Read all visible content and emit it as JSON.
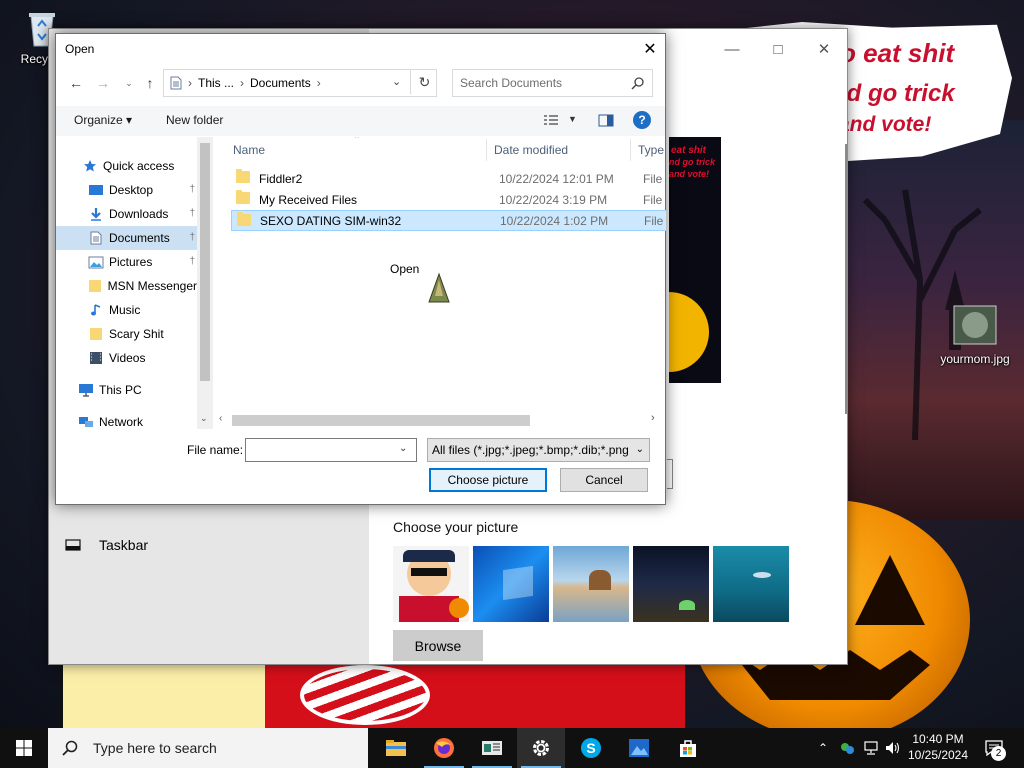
{
  "desktop": {
    "icons": [
      {
        "label": "Recycle"
      },
      {
        "label": "yourmom.jpg"
      }
    ],
    "wallpaper_text": [
      "o eat shit",
      "nd go trick",
      "and vote!"
    ]
  },
  "settings_window": {
    "nav_taskbar_label": "Taskbar",
    "choose_picture_label": "Choose your picture",
    "browse_label": "Browse",
    "preview_text": [
      "eat shit",
      "nd go trick",
      "and vote!"
    ]
  },
  "open_dialog": {
    "title": "Open",
    "address": {
      "crumb1": "This ...",
      "sep": "›",
      "crumb2": "Documents"
    },
    "search_placeholder": "Search Documents",
    "toolbar": {
      "organize": "Organize ▾",
      "new_folder": "New folder"
    },
    "nav_tree": [
      {
        "label": "Quick access",
        "icon": "star-icon"
      },
      {
        "label": "Desktop",
        "icon": "desktop-icon",
        "pinned": true
      },
      {
        "label": "Downloads",
        "icon": "download-icon",
        "pinned": true
      },
      {
        "label": "Documents",
        "icon": "document-icon",
        "pinned": true,
        "selected": true
      },
      {
        "label": "Pictures",
        "icon": "pictures-icon",
        "pinned": true
      },
      {
        "label": "MSN Messenger",
        "icon": "folder-icon"
      },
      {
        "label": "Music",
        "icon": "music-icon"
      },
      {
        "label": "Scary Shit",
        "icon": "folder-icon"
      },
      {
        "label": "Videos",
        "icon": "videos-icon"
      },
      {
        "label": "This PC",
        "icon": "computer-icon"
      },
      {
        "label": "Network",
        "icon": "network-icon"
      }
    ],
    "columns": {
      "name": "Name",
      "date": "Date modified",
      "type": "Type"
    },
    "files": [
      {
        "name": "Fiddler2",
        "date": "10/22/2024 12:01 PM",
        "type": "File fo"
      },
      {
        "name": "My Received Files",
        "date": "10/22/2024 3:19 PM",
        "type": "File fo"
      },
      {
        "name": "SEXO DATING SIM-win32",
        "date": "10/22/2024 1:02 PM",
        "type": "File fo",
        "selected": true
      }
    ],
    "drag_label": "Open",
    "file_name_label": "File name:",
    "file_name_value": "",
    "filter_label": "All files (*.jpg;*.jpeg;*.bmp;*.dib;*.png",
    "primary_button": "Choose picture",
    "cancel_button": "Cancel"
  },
  "taskbar": {
    "search_placeholder": "Type here to search",
    "clock_time": "10:40 PM",
    "clock_date": "10/25/2024",
    "notification_count": "2"
  }
}
